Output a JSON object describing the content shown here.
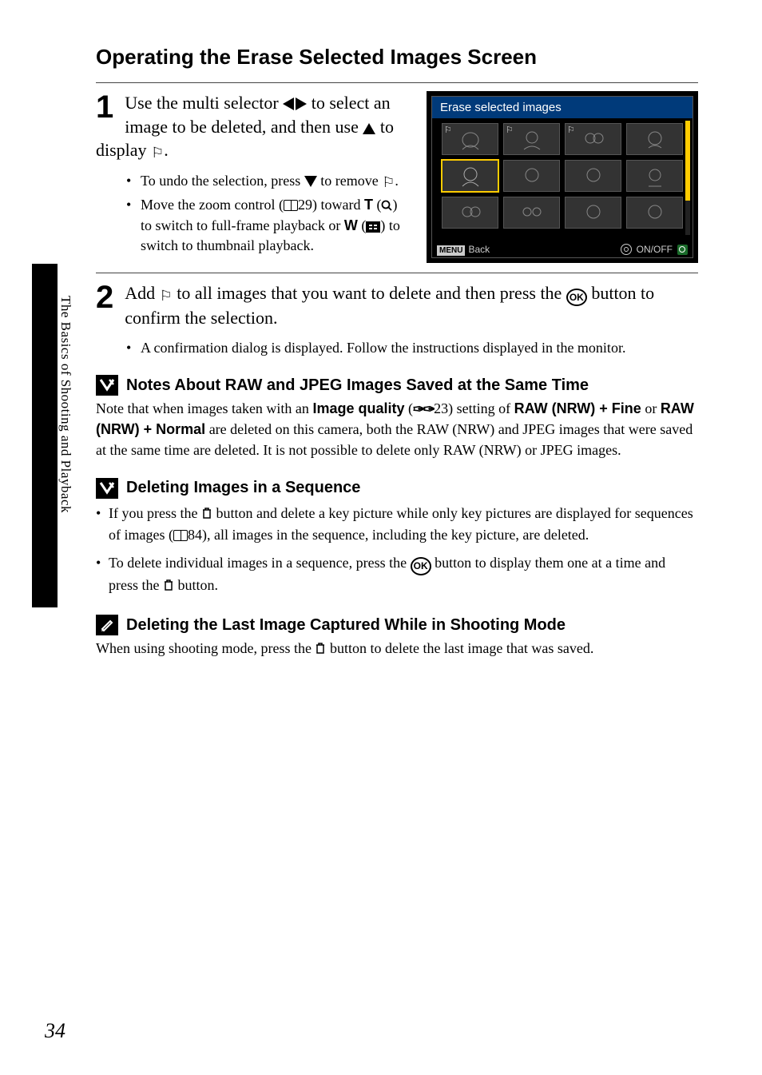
{
  "title": "Operating the Erase Selected Images Screen",
  "side_label": "The Basics of Shooting and Playback",
  "page_number": "34",
  "steps": {
    "s1": {
      "num": "1",
      "head_a": "Use the multi selector ",
      "head_b": " to select an image to be deleted, and then use ",
      "head_c": " to display ",
      "head_d": ".",
      "bullets": {
        "b1_a": "To undo the selection, press ",
        "b1_b": " to remove ",
        "b1_c": ".",
        "b2_a": "Move the zoom control (",
        "b2_ref": "29) toward ",
        "b2_T": "T",
        "b2_b": " (",
        "b2_c": ") to switch to full-frame playback or ",
        "b2_W": "W",
        "b2_d": " (",
        "b2_e": ") to switch to thumbnail playback."
      }
    },
    "s2": {
      "num": "2",
      "head_a": "Add ",
      "head_b": " to all images that you want to delete and then press the ",
      "head_c": " button to confirm the selection.",
      "bullet": "A confirmation dialog is displayed. Follow the instructions displayed in the monitor."
    }
  },
  "notes": {
    "n1": {
      "title": "Notes About RAW and JPEG Images Saved at the Same Time",
      "body_a": "Note that when images taken with an ",
      "body_b": "Image quality",
      "body_c": " (",
      "body_ref": "23) setting of ",
      "body_d": "RAW (NRW) + Fine",
      "body_e": " or ",
      "body_f": "RAW (NRW) + Normal",
      "body_g": " are deleted on this camera, both the RAW (NRW) and JPEG images that were saved at the same time are deleted. It is not possible to delete only RAW (NRW) or JPEG images."
    },
    "n2": {
      "title": "Deleting Images in a Sequence",
      "b1_a": "If you press the ",
      "b1_b": " button and delete a key picture while only key pictures are displayed for sequences of images (",
      "b1_ref": "84), all images in the sequence, including the key picture, are deleted.",
      "b2_a": "To delete individual images in a sequence, press the ",
      "b2_b": " button to display them one at a time and press the ",
      "b2_c": " button."
    },
    "n3": {
      "title": "Deleting the Last Image Captured While in Shooting Mode",
      "body_a": "When using shooting mode, press the ",
      "body_b": " button to delete the last image that was saved."
    }
  },
  "lcd": {
    "title": "Erase selected images",
    "menu": "MENU",
    "back": "Back",
    "onoff": "ON/OFF"
  }
}
